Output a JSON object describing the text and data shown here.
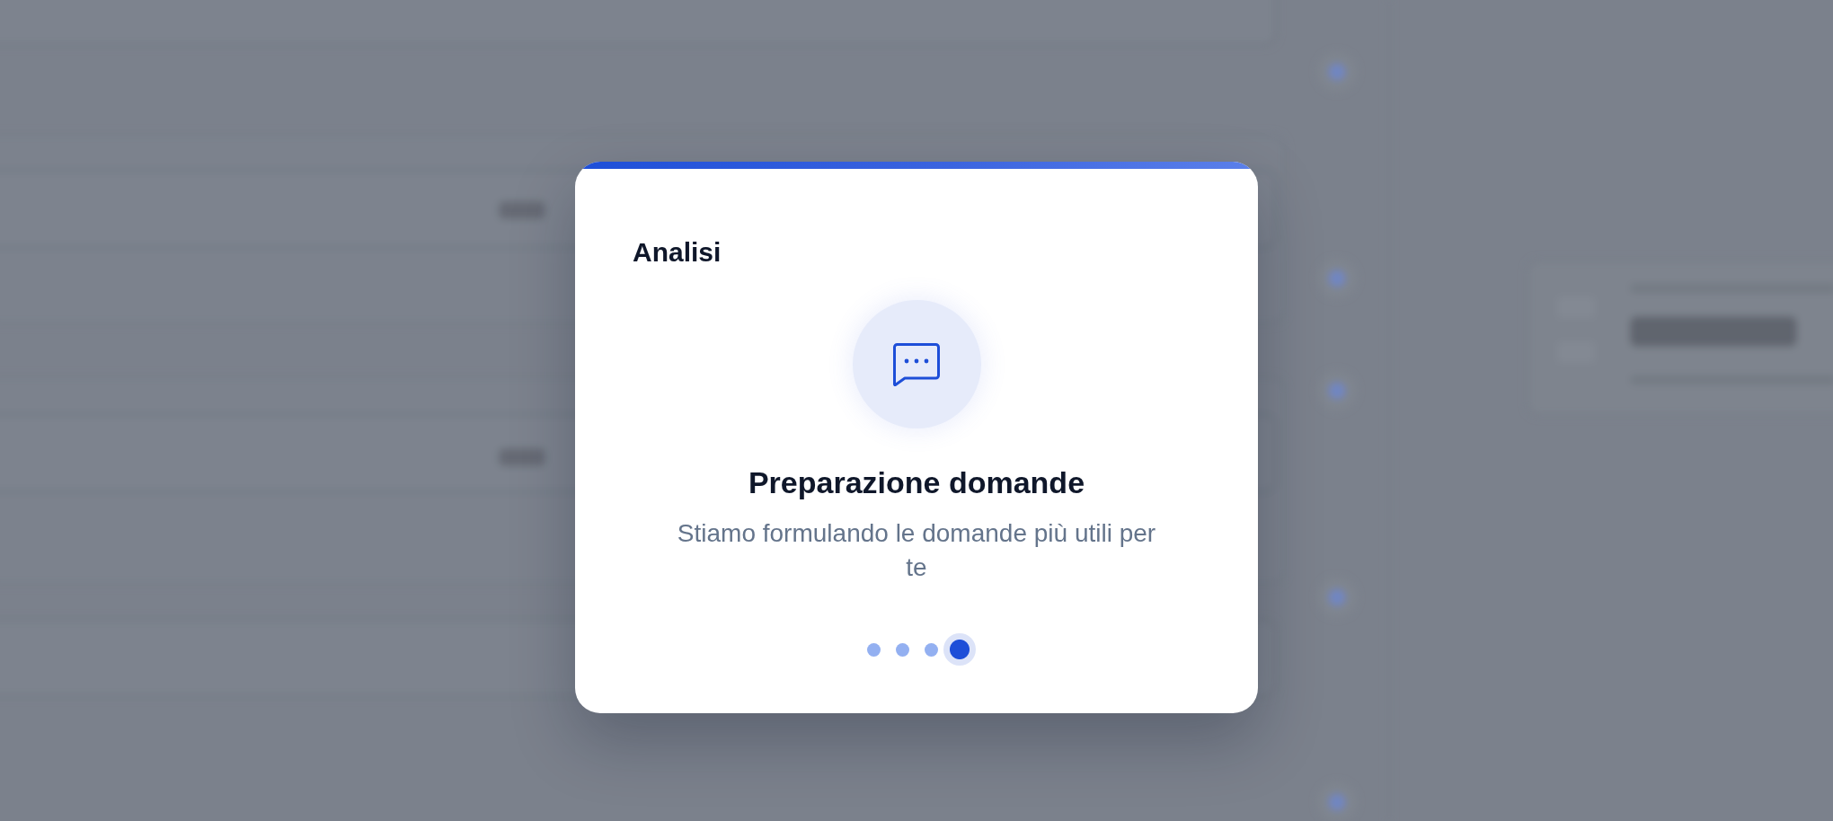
{
  "dialog": {
    "title": "Analisi"
  },
  "status": {
    "heading": "Preparazione domande",
    "message": "Stiamo formulando le domande più utili per te"
  },
  "steps": [
    {
      "selected": false
    },
    {
      "selected": false
    },
    {
      "selected": false
    },
    {
      "selected": true
    }
  ]
}
